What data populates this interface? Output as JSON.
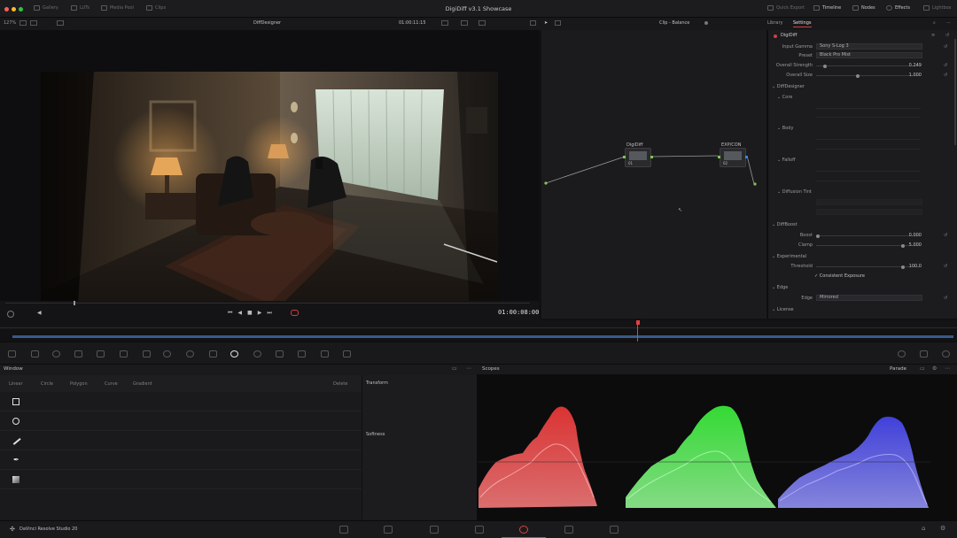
{
  "titlebar": {
    "app_title": "DigiDiff v3.1 Showcase",
    "left_items": [
      "Gallery",
      "LUTs",
      "Media Pool",
      "Clips"
    ],
    "right_items": [
      "Quick Export",
      "Timeline",
      "Nodes",
      "Effects",
      "Lightbox"
    ]
  },
  "viewer_bar": {
    "zoom": "127%",
    "clip_name": "DiffDesigner",
    "timecode": "01:00:11:15",
    "node_dropdown": "Clip - Balance"
  },
  "transport": {
    "timecode": "01:00:08:00"
  },
  "nodes": [
    {
      "label": "DigiDiff",
      "num": "01"
    },
    {
      "label": "EXP/CON",
      "num": "02"
    }
  ],
  "inspector": {
    "tabs": [
      "Library",
      "Settings"
    ],
    "plugin_name": "DigiDiff",
    "input_gamma_label": "Input Gamma",
    "input_gamma_value": "Sony S-Log 3",
    "preset_label": "Preset",
    "preset_value": "Black Pro Mist",
    "overall_strength_label": "Overall Strength",
    "overall_strength_value": "0.249",
    "overall_size_label": "Overall Size",
    "overall_size_value": "1.000",
    "section_diffdesigner": "DiffDesigner",
    "sub_core": "Core",
    "sub_body": "Body",
    "sub_falloff": "Falloff",
    "sub_diffusion_tint": "Diffusion Tint",
    "section_diffboost": "DiffBoost",
    "boost_label": "Boost",
    "boost_value": "0.000",
    "clamp_label": "Clamp",
    "clamp_value": "5.000",
    "section_experimental": "Experimental",
    "threshold_label": "Threshold",
    "threshold_value": "100.0",
    "consistent_exposure": "Consistent Exposure",
    "section_edge": "Edge",
    "edge_label": "Edge",
    "edge_value": "Mirrored",
    "section_license": "License"
  },
  "window_panel": {
    "title": "Window",
    "tools": [
      "Linear",
      "Circle",
      "Polygon",
      "Curve",
      "Gradient"
    ],
    "delete_label": "Delete",
    "transform_label": "Transform",
    "softness_label": "Softness"
  },
  "scopes_panel": {
    "title": "Scopes",
    "mode": "Parade",
    "colors": {
      "red": "#ff2a2a",
      "green": "#2aff3a",
      "blue": "#3a3aff"
    }
  },
  "bottombar": {
    "app_name": "DaVinci Resolve Studio 20"
  }
}
